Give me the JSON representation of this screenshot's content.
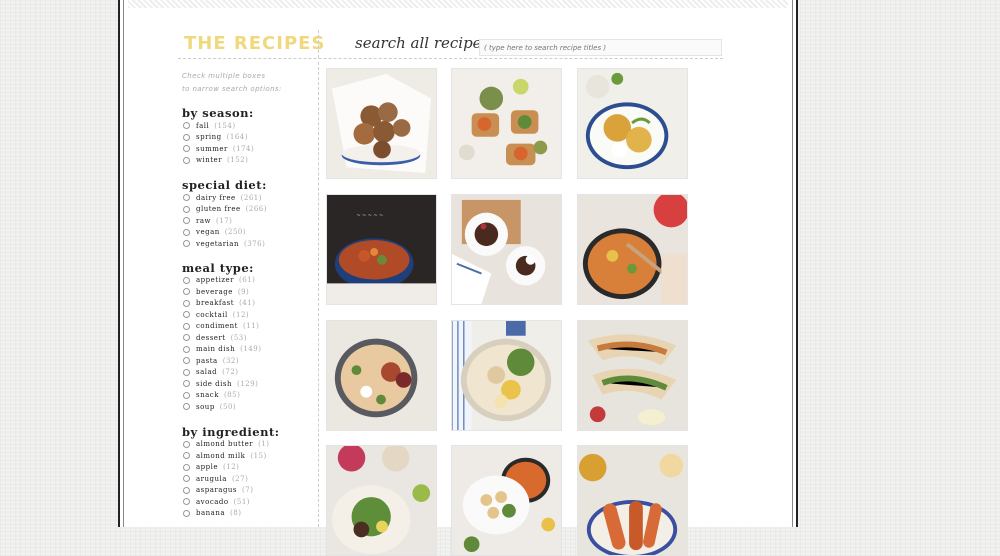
{
  "header": {
    "title": "THE RECIPES",
    "search_label": "search all recipes:",
    "search_placeholder": "( type here to search recipe titles )"
  },
  "sidebar": {
    "hint_line1": "Check multiple boxes",
    "hint_line2": "to narrow search options:",
    "sections": [
      {
        "title": "by season:",
        "options": [
          {
            "label": "fall",
            "count": "(154)"
          },
          {
            "label": "spring",
            "count": "(164)"
          },
          {
            "label": "summer",
            "count": "(174)"
          },
          {
            "label": "winter",
            "count": "(152)"
          }
        ]
      },
      {
        "title": "special diet:",
        "options": [
          {
            "label": "dairy free",
            "count": "(261)"
          },
          {
            "label": "gluten free",
            "count": "(266)"
          },
          {
            "label": "raw",
            "count": "(17)"
          },
          {
            "label": "vegan",
            "count": "(250)"
          },
          {
            "label": "vegetarian",
            "count": "(376)"
          }
        ]
      },
      {
        "title": "meal type:",
        "options": [
          {
            "label": "appetizer",
            "count": "(61)"
          },
          {
            "label": "beverage",
            "count": "(9)"
          },
          {
            "label": "breakfast",
            "count": "(41)"
          },
          {
            "label": "cocktail",
            "count": "(12)"
          },
          {
            "label": "condiment",
            "count": "(11)"
          },
          {
            "label": "dessert",
            "count": "(53)"
          },
          {
            "label": "main dish",
            "count": "(149)"
          },
          {
            "label": "pasta",
            "count": "(32)"
          },
          {
            "label": "salad",
            "count": "(72)"
          },
          {
            "label": "side dish",
            "count": "(129)"
          },
          {
            "label": "snack",
            "count": "(85)"
          },
          {
            "label": "soup",
            "count": "(50)"
          }
        ]
      },
      {
        "title": "by ingredient:",
        "options": [
          {
            "label": "almond butter",
            "count": "(1)"
          },
          {
            "label": "almond milk",
            "count": "(15)"
          },
          {
            "label": "apple",
            "count": "(12)"
          },
          {
            "label": "arugula",
            "count": "(27)"
          },
          {
            "label": "asparagus",
            "count": "(7)"
          },
          {
            "label": "avocado",
            "count": "(51)"
          },
          {
            "label": "banana",
            "count": "(8)"
          }
        ]
      }
    ]
  },
  "thumbnails": [
    {
      "name": "thumb-cookies",
      "bg": "#efece6",
      "accent": "#8a5a34",
      "type": "cookies"
    },
    {
      "name": "thumb-toasts",
      "bg": "#f2efea",
      "accent": "#d8652d",
      "type": "toasts"
    },
    {
      "name": "thumb-millet-cakes",
      "bg": "#f1efea",
      "accent": "#d9a23a",
      "type": "bowl"
    },
    {
      "name": "thumb-kale-stew",
      "bg": "#2a2626",
      "accent": "#c5572b",
      "type": "stew"
    },
    {
      "name": "thumb-chocolate-cakes",
      "bg": "#e8e4dd",
      "accent": "#4a2a1e",
      "type": "cakes"
    },
    {
      "name": "thumb-pan-pasta",
      "bg": "#e9e4de",
      "accent": "#d87f3a",
      "type": "pan"
    },
    {
      "name": "thumb-pasta-bowl",
      "bg": "#ebe8e2",
      "accent": "#a8482e",
      "type": "pasta"
    },
    {
      "name": "thumb-chickpea-salad",
      "bg": "#f0eee9",
      "accent": "#5e8a3a",
      "type": "salad"
    },
    {
      "name": "thumb-tacos",
      "bg": "#e7e3dd",
      "accent": "#c67a3e",
      "type": "tacos"
    },
    {
      "name": "thumb-burrito-bowl",
      "bg": "#eae7e2",
      "accent": "#5e8e3a",
      "type": "burrito"
    },
    {
      "name": "thumb-chickpea-bowl",
      "bg": "#eeebe6",
      "accent": "#d96a2e",
      "type": "chickpea"
    },
    {
      "name": "thumb-sweet-potato",
      "bg": "#e8e4de",
      "accent": "#d76a36",
      "type": "sweetpotato"
    }
  ]
}
